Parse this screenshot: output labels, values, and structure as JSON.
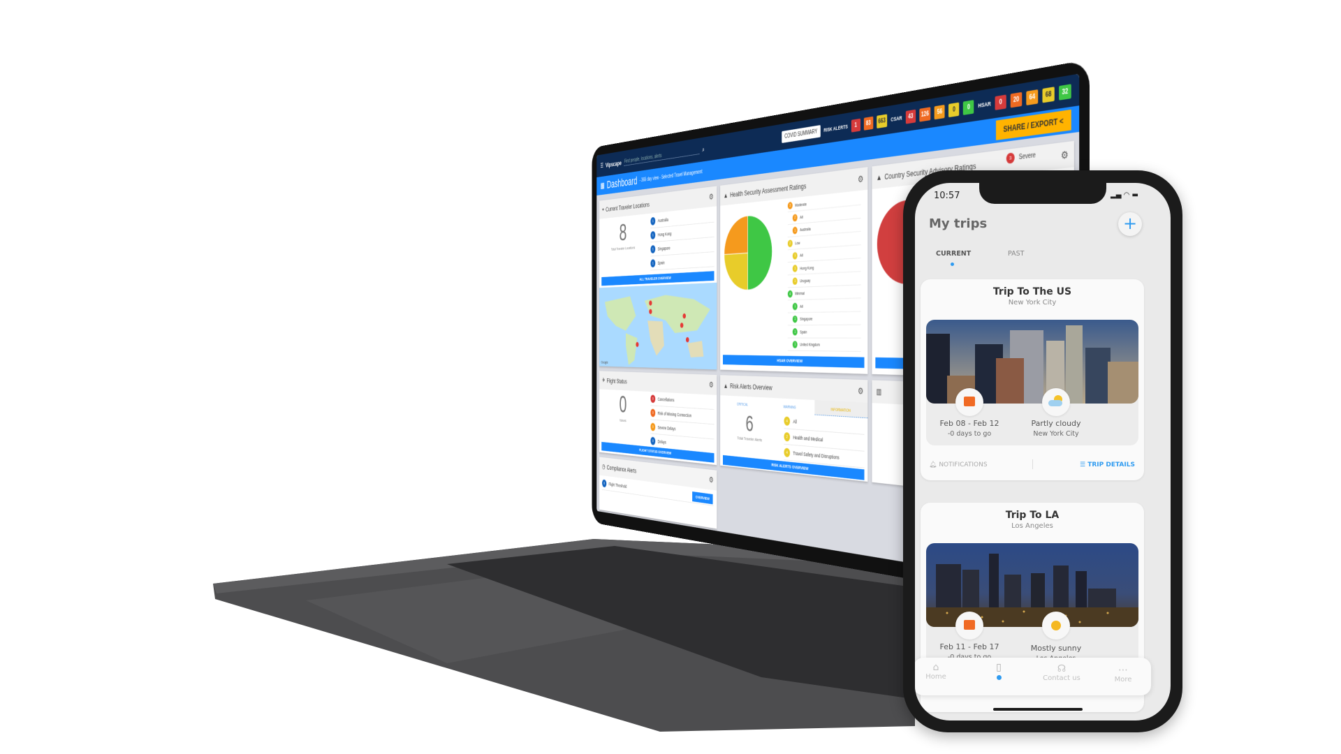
{
  "laptop": {
    "nav": {
      "logo": "Vipscape",
      "search_placeholder": "Find people, locations, alerts",
      "covid_label": "COVID SUMMARY",
      "risk_alerts": {
        "label": "RISK ALERTS",
        "values": [
          "1",
          "83",
          "663"
        ]
      },
      "csar": {
        "label": "CSAR",
        "values": [
          "43",
          "126",
          "56",
          "0",
          "0"
        ]
      },
      "hsar": {
        "label": "HSAR",
        "values": [
          "0",
          "20",
          "64",
          "68",
          "32"
        ]
      },
      "colors": {
        "red": "#d63b3b",
        "orange_red": "#ef6a22",
        "orange": "#f59a1d",
        "yellow": "#e8cc2a",
        "green": "#3fc745",
        "blue": "#1a88ff",
        "navy": "#0d2b55"
      }
    },
    "header": {
      "title": "Dashboard",
      "subtitle": "- 365 day view - Selected Travel Management",
      "share_label": "SHARE / EXPORT"
    },
    "traveler_locations": {
      "title": "Current Traveler Locations",
      "total": "8",
      "total_label": "Total Traveler Locations",
      "items": [
        {
          "n": "1",
          "label": "Australia"
        },
        {
          "n": "1",
          "label": "Hong Kong"
        },
        {
          "n": "1",
          "label": "Singapore"
        },
        {
          "n": "1",
          "label": "Spain"
        }
      ],
      "button": "ALL TRAVELER OVERVIEW",
      "map_credit": "Google"
    },
    "health_security": {
      "title": "Health Security Assessment Ratings",
      "groups": [
        {
          "n": "3",
          "label": "Moderate",
          "color": "#f59a1d",
          "items": [
            {
              "n": "2",
              "label": "All"
            },
            {
              "n": "1",
              "label": "Australia"
            }
          ]
        },
        {
          "n": "2",
          "label": "Low",
          "color": "#e8cc2a",
          "items": [
            {
              "n": "1",
              "label": "All"
            },
            {
              "n": "1",
              "label": "Hong Kong"
            },
            {
              "n": "1",
              "label": "Uruguay"
            }
          ]
        },
        {
          "n": "4",
          "label": "Minimal",
          "color": "#3fc745",
          "items": [
            {
              "n": "1",
              "label": "All"
            },
            {
              "n": "1",
              "label": "Singapore"
            },
            {
              "n": "1",
              "label": "Spain"
            },
            {
              "n": "1",
              "label": "United Kingdom"
            }
          ]
        }
      ],
      "pie": [
        {
          "label": "Minimal",
          "value": 50,
          "color": "#3fc745"
        },
        {
          "label": "Low",
          "value": 25,
          "color": "#e8cc2a"
        },
        {
          "label": "Moderate",
          "value": 25,
          "color": "#f59a1d"
        }
      ],
      "button": "HSAR OVERVIEW"
    },
    "country_security": {
      "title": "Country Security Advisory Ratings",
      "first_item": {
        "n": "3",
        "label": "Severe"
      }
    },
    "flight_status": {
      "title": "Flight Status",
      "total": "0",
      "total_label": "Issues",
      "items": [
        {
          "n": "0",
          "label": "Cancellations",
          "color": "#d63b3b"
        },
        {
          "n": "0",
          "label": "Risk of Missing Connection",
          "color": "#ef6a22"
        },
        {
          "n": "0",
          "label": "Severe Delays",
          "color": "#f59a1d"
        },
        {
          "n": "0",
          "label": "Delays",
          "color": "#1565c0"
        }
      ],
      "button": "FLIGHT STATUS OVERVIEW"
    },
    "risk_alerts": {
      "title": "Risk Alerts Overview",
      "tabs": [
        "CRITICAL",
        "WARNING",
        "INFORMATION"
      ],
      "active_tab": "INFORMATION",
      "total": "6",
      "total_label": "Total Traveler Alerts",
      "items": [
        {
          "n": "4",
          "label": "All"
        },
        {
          "n": "2",
          "label": "Health and Medical"
        },
        {
          "n": "4",
          "label": "Travel Safety and Disruptions"
        }
      ],
      "button": "RISK ALERTS OVERVIEW"
    },
    "compliance": {
      "title": "Compliance Alerts",
      "item": {
        "n": "0",
        "label": "Flight Threshold"
      },
      "button": "OVERVIEW"
    }
  },
  "phone": {
    "status": {
      "time": "10:57"
    },
    "title": "My trips",
    "tabs": [
      {
        "label": "CURRENT",
        "active": true
      },
      {
        "label": "PAST",
        "active": false
      }
    ],
    "accent": "#2f9bf0",
    "trips": [
      {
        "title": "Trip To The US",
        "city": "New York City",
        "dates": "Feb 08 - Feb 12",
        "countdown": "-0 days to go",
        "weather": "Partly cloudy",
        "weather_city": "New York City",
        "weather_icon": "partly-cloudy-icon"
      },
      {
        "title": "Trip To LA",
        "city": "Los Angeles",
        "dates": "Feb 11 - Feb 17",
        "countdown": "-0 days to go",
        "weather": "Mostly sunny",
        "weather_city": "Los Angeles",
        "weather_icon": "sun-icon"
      }
    ],
    "notifications_label": "NOTIFICATIONS",
    "trip_details_label": "TRIP DETAILS",
    "tabbar": [
      {
        "label": "Home",
        "icon": "home-icon"
      },
      {
        "label": "",
        "icon": "luggage-icon",
        "active": true
      },
      {
        "label": "Contact us",
        "icon": "headset-icon"
      },
      {
        "label": "More",
        "icon": "more-icon"
      }
    ]
  }
}
